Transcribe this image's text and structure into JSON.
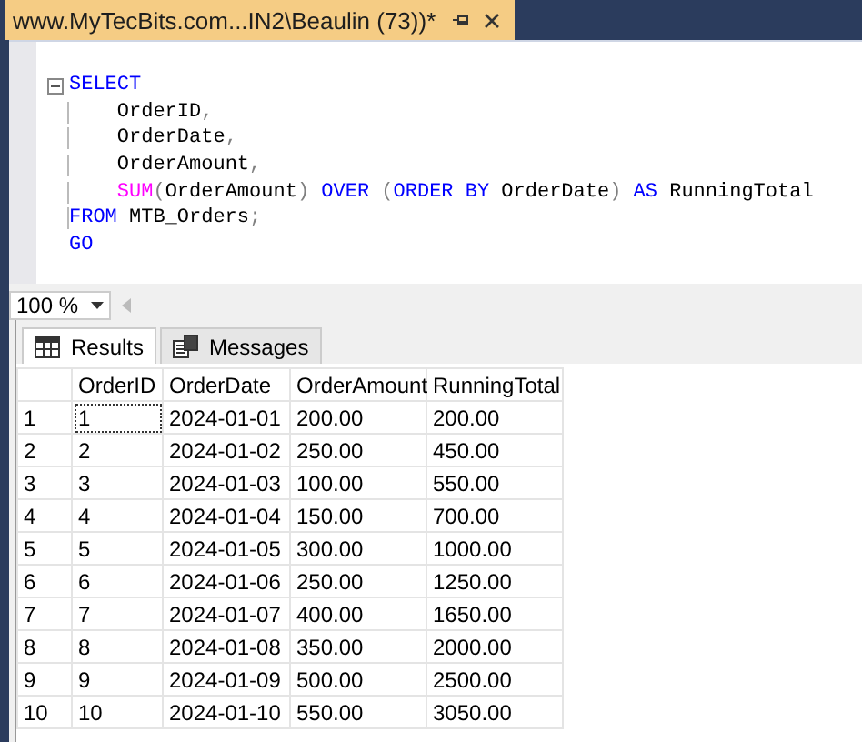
{
  "document_tab": {
    "title": "www.MyTecBits.com...IN2\\Beaulin (73))*",
    "selected": true
  },
  "editor": {
    "lines": [
      {
        "fold": true,
        "indented": false,
        "tokens": [
          {
            "kind": "keyword",
            "text": "SELECT"
          }
        ]
      },
      {
        "fold": false,
        "indented": true,
        "tokens": [
          {
            "kind": "identifier",
            "text": "OrderID"
          },
          {
            "kind": "operator",
            "text": ","
          }
        ]
      },
      {
        "fold": false,
        "indented": true,
        "tokens": [
          {
            "kind": "identifier",
            "text": "OrderDate"
          },
          {
            "kind": "operator",
            "text": ","
          }
        ]
      },
      {
        "fold": false,
        "indented": true,
        "tokens": [
          {
            "kind": "identifier",
            "text": "OrderAmount"
          },
          {
            "kind": "operator",
            "text": ","
          }
        ]
      },
      {
        "fold": false,
        "indented": true,
        "tokens": [
          {
            "kind": "function",
            "text": "SUM"
          },
          {
            "kind": "operator",
            "text": "("
          },
          {
            "kind": "identifier",
            "text": "OrderAmount"
          },
          {
            "kind": "operator",
            "text": ")"
          },
          {
            "kind": "keyword",
            "text": "OVER",
            "spaced": true
          },
          {
            "kind": "operator",
            "text": "(",
            "spaced": true
          },
          {
            "kind": "keyword",
            "text": "ORDER BY"
          },
          {
            "kind": "identifier",
            "text": "OrderDate",
            "spaced": true
          },
          {
            "kind": "operator",
            "text": ")"
          },
          {
            "kind": "keyword",
            "text": "AS",
            "spaced": true
          },
          {
            "kind": "identifier",
            "text": "RunningTotal",
            "spaced": true
          }
        ]
      },
      {
        "fold": false,
        "indented": false,
        "tokens": [
          {
            "kind": "keyword",
            "text": "FROM"
          },
          {
            "kind": "identifier",
            "text": "MTB_Orders",
            "spaced": true
          },
          {
            "kind": "operator",
            "text": ";"
          }
        ]
      },
      {
        "fold": false,
        "indented": false,
        "tokens": [
          {
            "kind": "keyword",
            "text": "GO"
          }
        ]
      }
    ]
  },
  "zoom": {
    "value": "100 %"
  },
  "result_tabs": [
    {
      "label": "Results",
      "kind": "grid",
      "selected": true
    },
    {
      "label": "Messages",
      "kind": "messages",
      "selected": false
    }
  ],
  "table": {
    "columns": [
      "OrderID",
      "OrderDate",
      "OrderAmount",
      "RunningTotal"
    ],
    "rows": [
      {
        "number": "1",
        "focused": true,
        "cells": [
          "1",
          "2024-01-01",
          "200.00",
          "200.00"
        ]
      },
      {
        "number": "2",
        "focused": false,
        "cells": [
          "2",
          "2024-01-02",
          "250.00",
          "450.00"
        ]
      },
      {
        "number": "3",
        "focused": false,
        "cells": [
          "3",
          "2024-01-03",
          "100.00",
          "550.00"
        ]
      },
      {
        "number": "4",
        "focused": false,
        "cells": [
          "4",
          "2024-01-04",
          "150.00",
          "700.00"
        ]
      },
      {
        "number": "5",
        "focused": false,
        "cells": [
          "5",
          "2024-01-05",
          "300.00",
          "1000.00"
        ]
      },
      {
        "number": "6",
        "focused": false,
        "cells": [
          "6",
          "2024-01-06",
          "250.00",
          "1250.00"
        ]
      },
      {
        "number": "7",
        "focused": false,
        "cells": [
          "7",
          "2024-01-07",
          "400.00",
          "1650.00"
        ]
      },
      {
        "number": "8",
        "focused": false,
        "cells": [
          "8",
          "2024-01-08",
          "350.00",
          "2000.00"
        ]
      },
      {
        "number": "9",
        "focused": false,
        "cells": [
          "9",
          "2024-01-09",
          "500.00",
          "2500.00"
        ]
      },
      {
        "number": "10",
        "focused": false,
        "cells": [
          "10",
          "2024-01-10",
          "550.00",
          "3050.00"
        ]
      }
    ]
  }
}
